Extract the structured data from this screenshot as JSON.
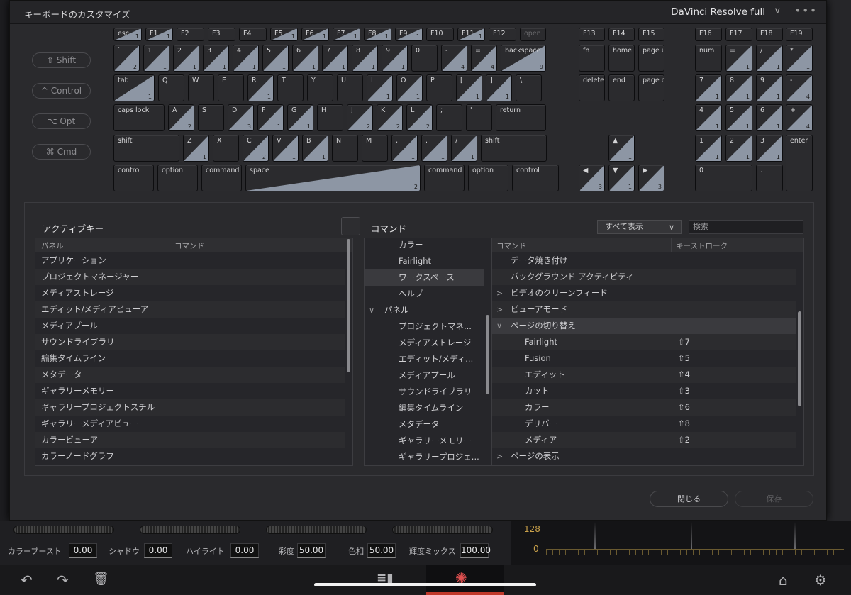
{
  "dialog": {
    "title": "キーボードのカスタマイズ",
    "preset": "DaVinci Resolve full",
    "more_icon": "more-horizontal-icon",
    "close_label": "閉じる",
    "save_label": "保存"
  },
  "modifiers": [
    "⇧ Shift",
    "^ Control",
    "⌥ Opt",
    "⌘ Cmd"
  ],
  "keyboard": {
    "function_row": [
      {
        "label": "esc",
        "count": "1"
      },
      {
        "label": "F1",
        "count": "1"
      },
      {
        "label": "F2",
        "count": ""
      },
      {
        "label": "F3",
        "count": ""
      },
      {
        "label": "F4",
        "count": ""
      },
      {
        "label": "F5",
        "count": "1"
      },
      {
        "label": "F6",
        "count": "1"
      },
      {
        "label": "F7",
        "count": "1"
      },
      {
        "label": "F8",
        "count": "1"
      },
      {
        "label": "F9",
        "count": "1"
      },
      {
        "label": "F10",
        "count": ""
      },
      {
        "label": "F11",
        "count": "1"
      },
      {
        "label": "F12",
        "count": ""
      },
      {
        "label": "open",
        "count": ""
      }
    ],
    "number_row": [
      {
        "label": "`",
        "count": "2"
      },
      {
        "label": "1",
        "count": "1"
      },
      {
        "label": "2",
        "count": "1"
      },
      {
        "label": "3",
        "count": "1"
      },
      {
        "label": "4",
        "count": "1"
      },
      {
        "label": "5",
        "count": "1"
      },
      {
        "label": "6",
        "count": "1"
      },
      {
        "label": "7",
        "count": "1"
      },
      {
        "label": "8",
        "count": "1"
      },
      {
        "label": "9",
        "count": "1"
      },
      {
        "label": "0",
        "count": ""
      },
      {
        "label": "-",
        "count": "4"
      },
      {
        "label": "=",
        "count": "4"
      },
      {
        "label": "backspace",
        "count": "9"
      }
    ],
    "tab_row": [
      {
        "label": "tab",
        "count": "1"
      },
      {
        "label": "Q",
        "count": ""
      },
      {
        "label": "W",
        "count": ""
      },
      {
        "label": "E",
        "count": ""
      },
      {
        "label": "R",
        "count": "1"
      },
      {
        "label": "T",
        "count": ""
      },
      {
        "label": "Y",
        "count": ""
      },
      {
        "label": "U",
        "count": ""
      },
      {
        "label": "I",
        "count": "1"
      },
      {
        "label": "O",
        "count": "1"
      },
      {
        "label": "P",
        "count": ""
      },
      {
        "label": "[",
        "count": "1"
      },
      {
        "label": "]",
        "count": "1"
      },
      {
        "label": "\\",
        "count": ""
      }
    ],
    "caps_row": [
      {
        "label": "caps lock",
        "count": ""
      },
      {
        "label": "A",
        "count": "2"
      },
      {
        "label": "S",
        "count": ""
      },
      {
        "label": "D",
        "count": "3"
      },
      {
        "label": "F",
        "count": "1"
      },
      {
        "label": "G",
        "count": "1"
      },
      {
        "label": "H",
        "count": ""
      },
      {
        "label": "J",
        "count": "2"
      },
      {
        "label": "K",
        "count": "2"
      },
      {
        "label": "L",
        "count": "2"
      },
      {
        "label": ";",
        "count": ""
      },
      {
        "label": "'",
        "count": ""
      },
      {
        "label": "return",
        "count": ""
      }
    ],
    "shift_row": [
      {
        "label": "shift",
        "count": ""
      },
      {
        "label": "Z",
        "count": "1"
      },
      {
        "label": "X",
        "count": ""
      },
      {
        "label": "C",
        "count": "2"
      },
      {
        "label": "V",
        "count": "1"
      },
      {
        "label": "B",
        "count": "1"
      },
      {
        "label": "N",
        "count": ""
      },
      {
        "label": "M",
        "count": ""
      },
      {
        "label": ",",
        "count": "1"
      },
      {
        "label": ".",
        "count": "1"
      },
      {
        "label": "/",
        "count": "1"
      },
      {
        "label": "shift",
        "count": ""
      }
    ],
    "bottom_row": [
      {
        "label": "control",
        "count": ""
      },
      {
        "label": "option",
        "count": ""
      },
      {
        "label": "command",
        "count": ""
      },
      {
        "label": "space",
        "count": "2"
      },
      {
        "label": "command",
        "count": ""
      },
      {
        "label": "option",
        "count": ""
      },
      {
        "label": "control",
        "count": ""
      }
    ],
    "nav_keys": [
      {
        "label": "F13",
        "count": ""
      },
      {
        "label": "F14",
        "count": ""
      },
      {
        "label": "F15",
        "count": ""
      },
      {
        "label": "fn",
        "count": ""
      },
      {
        "label": "home",
        "count": ""
      },
      {
        "label": "page up",
        "count": ""
      },
      {
        "label": "delete",
        "count": ""
      },
      {
        "label": "end",
        "count": ""
      },
      {
        "label": "page down",
        "count": ""
      },
      {
        "label": "▲",
        "count": "1"
      },
      {
        "label": "◀",
        "count": "3"
      },
      {
        "label": "▼",
        "count": "1"
      },
      {
        "label": "▶",
        "count": "3"
      }
    ],
    "numpad": [
      {
        "label": "F16",
        "count": ""
      },
      {
        "label": "F17",
        "count": ""
      },
      {
        "label": "F18",
        "count": ""
      },
      {
        "label": "F19",
        "count": ""
      },
      {
        "label": "num",
        "count": ""
      },
      {
        "label": "=",
        "count": "1"
      },
      {
        "label": "/",
        "count": "1"
      },
      {
        "label": "*",
        "count": "1"
      },
      {
        "label": "7",
        "count": "1"
      },
      {
        "label": "8",
        "count": "1"
      },
      {
        "label": "9",
        "count": "1"
      },
      {
        "label": "-",
        "count": "4"
      },
      {
        "label": "4",
        "count": "1"
      },
      {
        "label": "5",
        "count": "1"
      },
      {
        "label": "6",
        "count": "1"
      },
      {
        "label": "+",
        "count": "4"
      },
      {
        "label": "1",
        "count": "1"
      },
      {
        "label": "2",
        "count": "1"
      },
      {
        "label": "3",
        "count": "1"
      },
      {
        "label": "enter",
        "count": ""
      },
      {
        "label": "0",
        "count": ""
      },
      {
        "label": ".",
        "count": ""
      }
    ]
  },
  "active_keys": {
    "title": "アクティブキー",
    "col_panel": "パネル",
    "col_command": "コマンド",
    "rows": [
      "アプリケーション",
      "プロジェクトマネージャー",
      "メディアストレージ",
      "エディット/メディアビューア",
      "メディアプール",
      "サウンドライブラリ",
      "編集タイムライン",
      "メタデータ",
      "ギャラリーメモリー",
      "ギャラリープロジェクトスチル",
      "ギャラリーメディアビュー",
      "カラービューア",
      "カラーノードグラフ"
    ]
  },
  "commands": {
    "title": "コマンド",
    "filter": "すべて表示",
    "search_placeholder": "検索",
    "tree": [
      {
        "label": "カラー",
        "indent": 1,
        "chev": ""
      },
      {
        "label": "Fairlight",
        "indent": 1,
        "chev": ""
      },
      {
        "label": "ワークスペース",
        "indent": 1,
        "chev": "",
        "selected": true
      },
      {
        "label": "ヘルプ",
        "indent": 1,
        "chev": ""
      },
      {
        "label": "パネル",
        "indent": 0,
        "chev": "∨"
      },
      {
        "label": "プロジェクトマネ...",
        "indent": 2,
        "chev": ""
      },
      {
        "label": "メディアストレージ",
        "indent": 2,
        "chev": ""
      },
      {
        "label": "エディット/メディ...",
        "indent": 2,
        "chev": ""
      },
      {
        "label": "メディアプール",
        "indent": 2,
        "chev": ""
      },
      {
        "label": "サウンドライブラリ",
        "indent": 2,
        "chev": ""
      },
      {
        "label": "編集タイムライン",
        "indent": 2,
        "chev": ""
      },
      {
        "label": "メタデータ",
        "indent": 2,
        "chev": ""
      },
      {
        "label": "ギャラリーメモリー",
        "indent": 2,
        "chev": ""
      },
      {
        "label": "ギャラリープロジェ...",
        "indent": 2,
        "chev": ""
      }
    ],
    "col_command": "コマンド",
    "col_keystroke": "キーストローク",
    "list": [
      {
        "label": "データ焼き付け",
        "chev": "",
        "indent": 1,
        "key": ""
      },
      {
        "label": "バックグラウンド アクティビティ",
        "chev": "",
        "indent": 1,
        "key": ""
      },
      {
        "label": "ビデオのクリーンフィード",
        "chev": ">",
        "indent": 1,
        "key": ""
      },
      {
        "label": "ビューアモード",
        "chev": ">",
        "indent": 1,
        "key": ""
      },
      {
        "label": "ページの切り替え",
        "chev": "∨",
        "indent": 1,
        "key": "",
        "selected": true
      },
      {
        "label": "Fairlight",
        "chev": "",
        "indent": 2,
        "key": "⇧7"
      },
      {
        "label": "Fusion",
        "chev": "",
        "indent": 2,
        "key": "⇧5"
      },
      {
        "label": "エディット",
        "chev": "",
        "indent": 2,
        "key": "⇧4"
      },
      {
        "label": "カット",
        "chev": "",
        "indent": 2,
        "key": "⇧3"
      },
      {
        "label": "カラー",
        "chev": "",
        "indent": 2,
        "key": "⇧6"
      },
      {
        "label": "デリバー",
        "chev": "",
        "indent": 2,
        "key": "⇧8"
      },
      {
        "label": "メディア",
        "chev": "",
        "indent": 2,
        "key": "⇧2"
      },
      {
        "label": "ページの表示",
        "chev": ">",
        "indent": 1,
        "key": ""
      }
    ]
  },
  "color_params": [
    {
      "label": "カラーブースト",
      "value": "0.00"
    },
    {
      "label": "シャドウ",
      "value": "0.00"
    },
    {
      "label": "ハイライト",
      "value": "0.00"
    },
    {
      "label": "彩度",
      "value": "50.00"
    },
    {
      "label": "色相",
      "value": "50.00"
    },
    {
      "label": "輝度ミックス",
      "value": "100.00"
    }
  ],
  "scope": {
    "labels": [
      "128",
      "0"
    ]
  },
  "footer_icons": [
    "undo-icon",
    "redo-icon",
    "trash-icon",
    "cut-page-icon",
    "color-page-icon",
    "home-icon",
    "settings-gear-icon"
  ],
  "colors": {
    "assigned": "#8d96a4",
    "accent": "#c0392b"
  }
}
